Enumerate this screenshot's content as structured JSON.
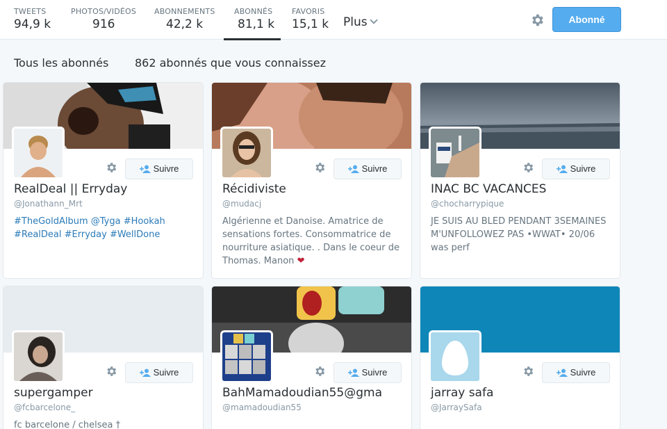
{
  "nav": {
    "stats": [
      {
        "label": "TWEETS",
        "value": "94,9 k"
      },
      {
        "label": "PHOTOS/VIDÉOS",
        "value": "916"
      },
      {
        "label": "ABONNEMENTS",
        "value": "42,2 k"
      },
      {
        "label": "ABONNÉS",
        "value": "81,1 k"
      },
      {
        "label": "FAVORIS",
        "value": "15,1 k"
      }
    ],
    "more_label": "Plus",
    "follow_label": "Abonné",
    "gear_icon": "gear-icon"
  },
  "subheader": {
    "all_label": "Tous les abonnés",
    "known_label": "862 abonnés que vous connaissez"
  },
  "follow_button_label": "Suivre",
  "cards": [
    {
      "name": "RealDeal || Erryday",
      "handle": "@Jonathann_Mrt",
      "bio": "#TheGoldAlbum @Tyga #Hookah #RealDeal #Erryday #WellDone"
    },
    {
      "name": "Récidiviste",
      "handle": "@mudacj",
      "bio": "Algérienne et Danoise. Amatrice de sensations fortes. Consommatrice de nourriture asiatique. . Dans le coeur de Thomas. Manon ",
      "bio_emoji": "❤"
    },
    {
      "name": "INAC BC VACANCES",
      "handle": "@chocharrypique",
      "bio": "JE SUIS AU BLED PENDANT 3SEMAINES M'UNFOLLOWEZ PAS •WWAT• 20/06 was perf"
    },
    {
      "name": "supergamper",
      "handle": "@fcbarcelone_",
      "bio": "fc barcelone / chelsea †"
    },
    {
      "name": "BahMamadoudian55@gma",
      "handle": "@mamadoudian55",
      "bio": ""
    },
    {
      "name": "jarray safa",
      "handle": "@JarraySafa",
      "bio": ""
    }
  ],
  "colors": {
    "accent": "#55acee",
    "link": "#2b7bb9",
    "banner_blue": "#0f86b8",
    "banner_grey": "#e6ecf0"
  }
}
